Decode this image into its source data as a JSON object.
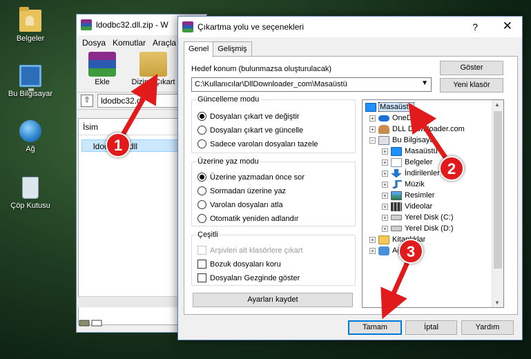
{
  "desktop": {
    "icons": [
      "Belgeler",
      "Bu Bilgisayar",
      "Ağ",
      "Çöp Kutusu"
    ]
  },
  "winrar": {
    "title": "ldodbc32.dll.zip - W",
    "menu": [
      "Dosya",
      "Komutlar",
      "Araçla"
    ],
    "toolbar": {
      "add": "Ekle",
      "extract": "Dizine Çıkart"
    },
    "address": "ldodbc32.dl",
    "column_name": "İsim",
    "file": "ldodbc32.dll"
  },
  "dialog": {
    "title": "Çıkartma yolu ve seçenekleri",
    "help_glyph": "?",
    "close_glyph": "✕",
    "tabs": [
      "Genel",
      "Gelişmiş"
    ],
    "dest_label": "Hedef konum (bulunmazsa oluşturulacak)",
    "dest_path": "C:\\Kullanıcılar\\DllDownloader_com\\Masaüstü",
    "show_button": "Göster",
    "new_folder_button": "Yeni klasör",
    "update_mode": {
      "legend": "Güncelleme modu",
      "options": [
        "Dosyaları çıkart ve değiştir",
        "Dosyaları çıkart ve güncelle",
        "Sadece varolan dosyaları tazele"
      ],
      "selected": 0
    },
    "overwrite_mode": {
      "legend": "Üzerine yaz modu",
      "options": [
        "Üzerine yazmadan önce sor",
        "Sormadan üzerine yaz",
        "Varolan dosyaları atla",
        "Otomatik yeniden adlandır"
      ],
      "selected": 0
    },
    "misc": {
      "legend": "Çeşitli",
      "options": [
        "Arşivleri alt klasörlere çıkart",
        "Bozuk dosyaları koru",
        "Dosyaları Gezginde göster"
      ],
      "disabled_index": 0
    },
    "save_settings": "Ayarları kaydet",
    "tree": [
      "Masaüstü",
      "OneD",
      "DLL Downloader.com",
      "Bu Bilgisaya",
      "Masaüstü",
      "Belgeler",
      "İndirilenler",
      "Müzik",
      "Resimler",
      "Videolar",
      "Yerel Disk (C:)",
      "Yerel Disk (D:)",
      "Kitaplıklar",
      "Ağ"
    ],
    "ok_button": "Tamam",
    "cancel_button": "İptal",
    "help_button": "Yardım"
  },
  "annotations": {
    "steps": [
      "1",
      "2",
      "3"
    ],
    "color": "#e11b1b"
  }
}
